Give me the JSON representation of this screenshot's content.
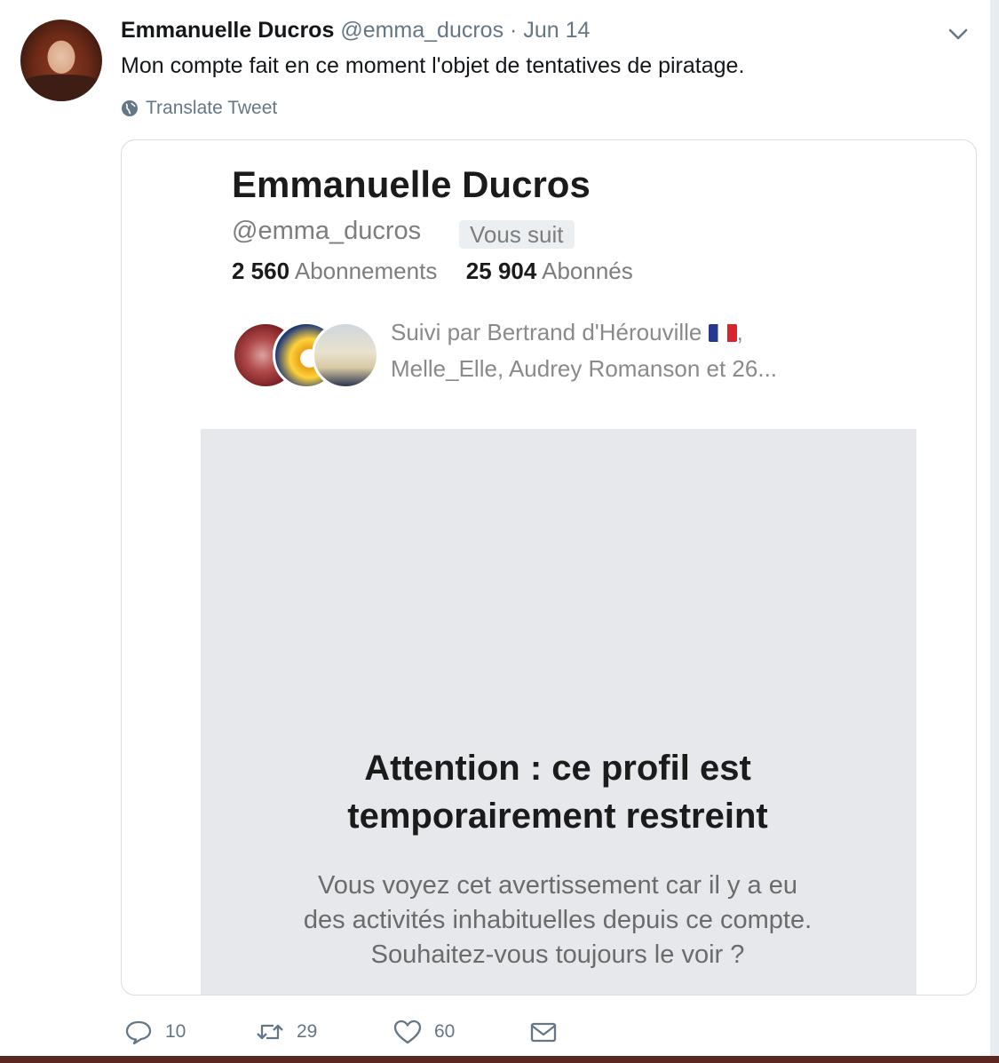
{
  "tweet": {
    "author_name": "Emmanuelle Ducros",
    "author_handle": "@emma_ducros",
    "separator": "·",
    "date": "Jun 14",
    "text": "Mon compte fait en ce moment l'objet de tentatives de piratage.",
    "translate_label": "Translate Tweet"
  },
  "card": {
    "profile_name": "Emmanuelle Ducros",
    "profile_handle": "@emma_ducros",
    "follows_you_badge": "Vous suit",
    "following_count": "2 560",
    "following_label": "Abonnements",
    "followers_count": "25 904",
    "followers_label": "Abonnés",
    "followed_by_line1": "Suivi par Bertrand d'Hérouville",
    "followed_by_flag": "flag-fr-icon",
    "followed_by_comma": ",",
    "followed_by_line2": "Melle_Elle, Audrey Romanson et 26...",
    "warning_title_line1": "Attention : ce profil est",
    "warning_title_line2": "temporairement restreint",
    "warning_body_line1": "Vous voyez cet avertissement car il y a eu",
    "warning_body_line2": "des activités inhabituelles depuis ce compte.",
    "warning_body_line3": "Souhaitez-vous toujours le voir ?"
  },
  "actions": {
    "reply_count": "10",
    "retweet_count": "29",
    "like_count": "60",
    "reply_icon": "reply-icon",
    "retweet_icon": "retweet-icon",
    "like_icon": "heart-icon",
    "dm_icon": "envelope-icon"
  },
  "colors": {
    "secondary_text": "#657786",
    "restricted_bg": "#e6e8ec",
    "bottom_bar": "#5a2820"
  }
}
